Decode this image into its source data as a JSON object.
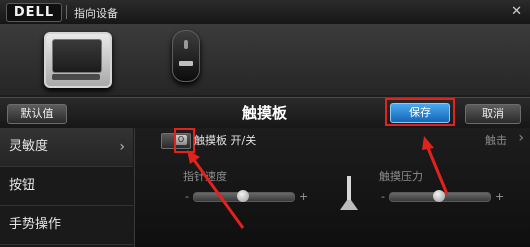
{
  "window": {
    "brand": "DELL",
    "title": "指向设备",
    "close_glyph": "✕"
  },
  "devices": {
    "items": [
      {
        "name": "touchpad",
        "icon": "touchpad-device-icon",
        "selected": true
      },
      {
        "name": "mouse",
        "icon": "mouse-device-icon",
        "selected": false
      }
    ]
  },
  "toolbar": {
    "default_label": "默认值",
    "page_title": "触摸板",
    "save_label": "保存",
    "cancel_label": "取消"
  },
  "sidebar": {
    "items": [
      {
        "label": "灵敏度",
        "chevron": "›",
        "active": true
      },
      {
        "label": "按钮",
        "active": false
      },
      {
        "label": "手势操作",
        "active": false
      }
    ]
  },
  "main": {
    "touchpad_toggle": {
      "label": "触摸板 开/关",
      "knob_text": "O",
      "state": "off"
    },
    "tap_label": "触击",
    "tap_chevron": "›",
    "pointer_speed": {
      "label": "指针速度",
      "minus": "-",
      "plus": "+",
      "value": 0.5
    },
    "touch_pressure": {
      "label": "触摸压力",
      "minus": "-",
      "plus": "+",
      "value": 0.5
    }
  },
  "annotations": {
    "highlight_color": "#e2221c"
  },
  "colors": {
    "accent_save": "#2a8de0",
    "background": "#151515"
  }
}
